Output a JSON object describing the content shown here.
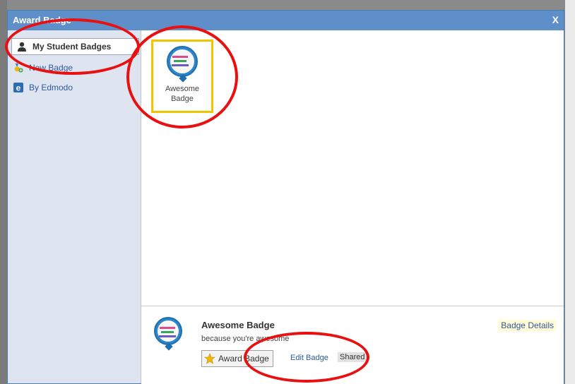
{
  "dialog": {
    "title": "Award Badge",
    "close_label": "X"
  },
  "sidebar": {
    "items": [
      {
        "label": "My Student Badges",
        "icon": "person-icon",
        "active": true
      },
      {
        "label": "New Badge",
        "icon": "new-badge-icon"
      },
      {
        "label": "By Edmodo",
        "icon": "edmodo-logo-icon"
      }
    ]
  },
  "badges": [
    {
      "label_line1": "Awesome",
      "label_line2": "Badge",
      "selected": true
    }
  ],
  "detail": {
    "name": "Awesome Badge",
    "reason": "because you're awesome",
    "details_link": "Badge Details",
    "award_button": "Award Badge",
    "edit_link": "Edit Badge",
    "shared_label": "Shared"
  },
  "colors": {
    "title_bar": "#5f8fc8",
    "sidebar_bg": "#dfe5f0",
    "selection_border": "#f0c400",
    "link": "#2d5a9c",
    "annotation": "#e81010"
  }
}
